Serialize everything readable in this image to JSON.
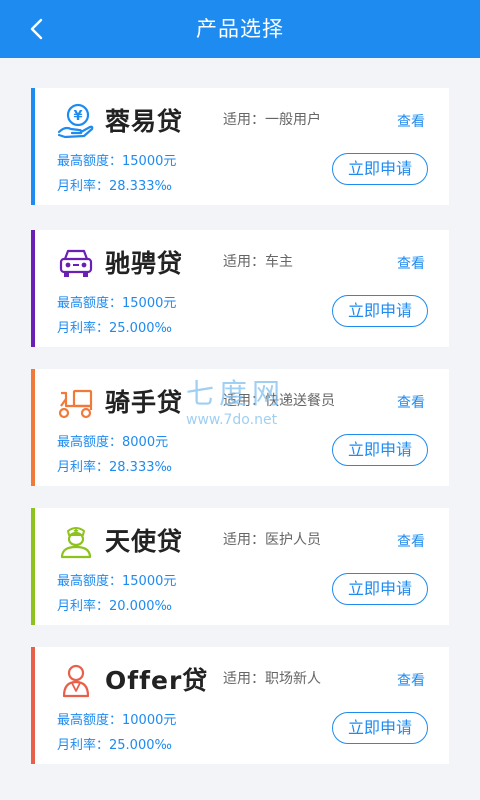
{
  "header": {
    "title": "产品选择",
    "back_icon": "chevron-left-icon"
  },
  "colors": {
    "primary": "#1e8bf0",
    "header_bg": "#1e8bf0",
    "page_bg": "#f2f4f7"
  },
  "products": [
    {
      "name": "蓉易贷",
      "suitable": "适用：一般用户",
      "view": "查看",
      "limit": "最高额度：15000元",
      "rate": "月利率：28.333‰",
      "apply": "立即申请",
      "accent": "#1e8bf0",
      "icon": "hand-coin-icon"
    },
    {
      "name": "驰骋贷",
      "suitable": "适用：车主",
      "view": "查看",
      "limit": "最高额度：15000元",
      "rate": "月利率：25.000‰",
      "apply": "立即申请",
      "accent": "#6a1fb5",
      "icon": "car-icon"
    },
    {
      "name": "骑手贷",
      "suitable": "适用：快递送餐员",
      "view": "查看",
      "limit": "最高额度：8000元",
      "rate": "月利率：28.333‰",
      "apply": "立即申请",
      "accent": "#f07a3a",
      "icon": "delivery-tricycle-icon"
    },
    {
      "name": "天使贷",
      "suitable": "适用：医护人员",
      "view": "查看",
      "limit": "最高额度：15000元",
      "rate": "月利率：20.000‰",
      "apply": "立即申请",
      "accent": "#8dc21f",
      "icon": "nurse-icon"
    },
    {
      "name": "Offer贷",
      "suitable": "适用：职场新人",
      "view": "查看",
      "limit": "最高额度：10000元",
      "rate": "月利率：25.000‰",
      "apply": "立即申请",
      "accent": "#e8604a",
      "icon": "person-icon"
    }
  ],
  "watermark": {
    "text": "七度网",
    "url": "www.7do.net"
  }
}
